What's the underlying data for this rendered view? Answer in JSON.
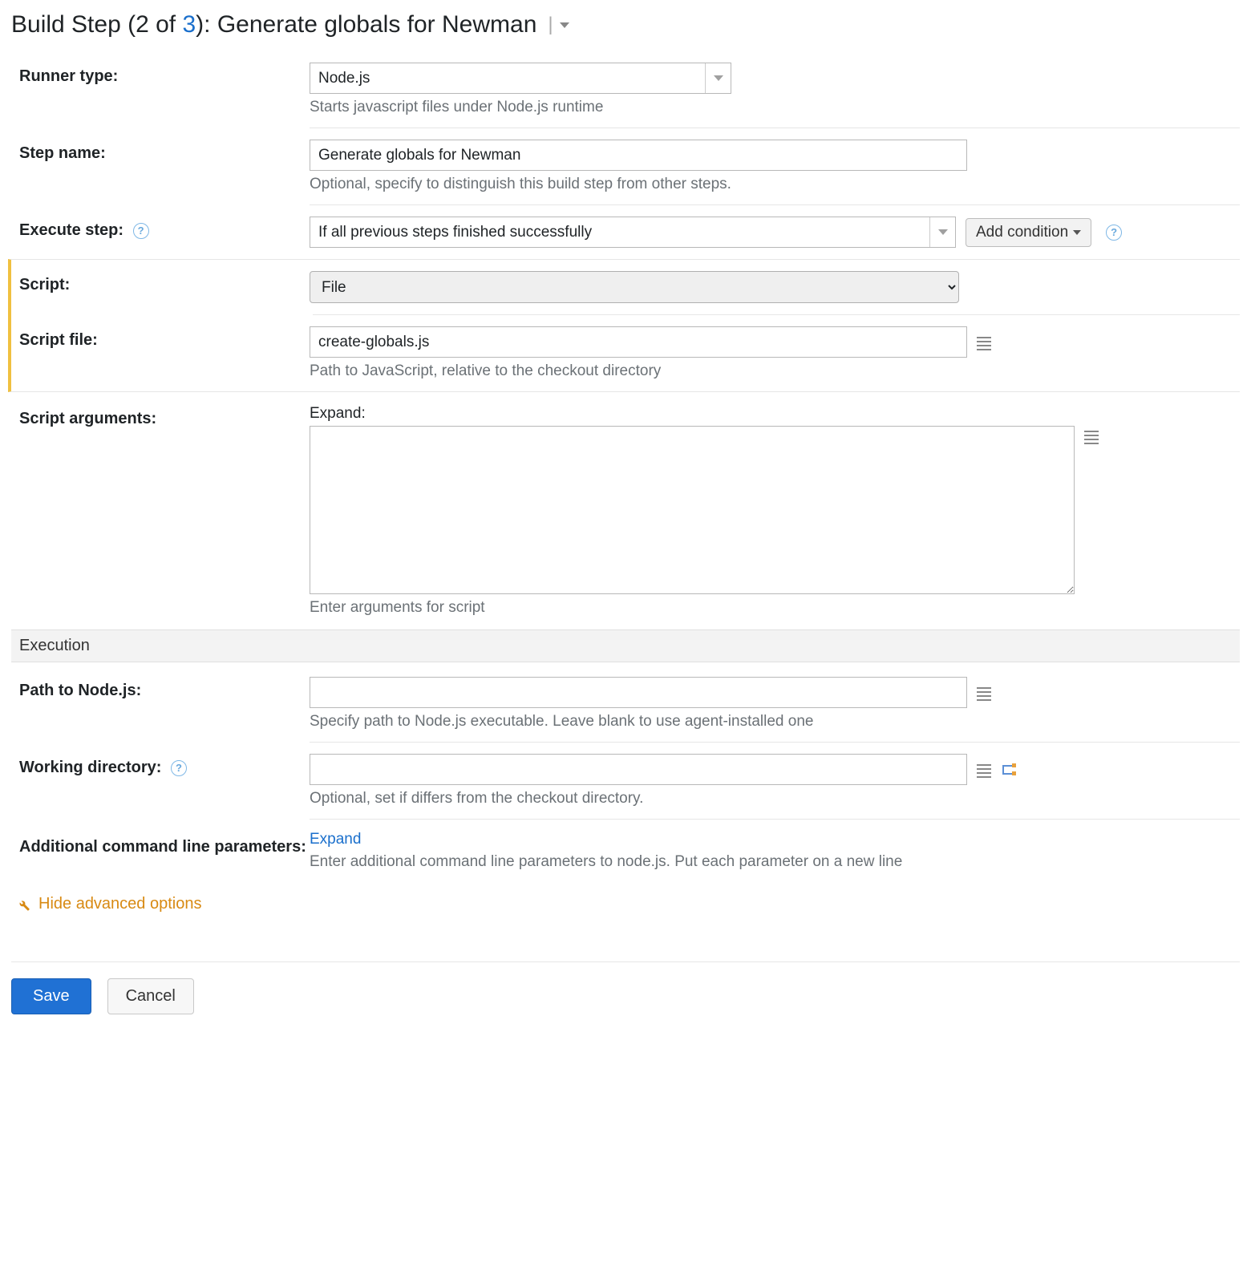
{
  "title": {
    "prefix": "Build Step (",
    "current": "2",
    "of": " of ",
    "total": "3",
    "suffix": "): Generate globals for Newman"
  },
  "runner": {
    "label": "Runner type:",
    "value": "Node.js",
    "help": "Starts javascript files under Node.js runtime"
  },
  "stepName": {
    "label": "Step name:",
    "value": "Generate globals for Newman",
    "help": "Optional, specify to distinguish this build step from other steps."
  },
  "executeStep": {
    "label": "Execute step:",
    "value": "If all previous steps finished successfully",
    "addCondition": "Add condition"
  },
  "script": {
    "label": "Script:",
    "value": "File"
  },
  "scriptFile": {
    "label": "Script file:",
    "value": "create-globals.js",
    "help": "Path to JavaScript, relative to the checkout directory"
  },
  "scriptArgs": {
    "label": "Script arguments:",
    "expand": "Expand:",
    "value": "",
    "help": "Enter arguments for script"
  },
  "execution": {
    "header": "Execution"
  },
  "pathNode": {
    "label": "Path to Node.js:",
    "value": "",
    "help": "Specify path to Node.js executable. Leave blank to use agent-installed one"
  },
  "workingDir": {
    "label": "Working directory:",
    "value": "",
    "help": "Optional, set if differs from the checkout directory."
  },
  "additionalParams": {
    "label": "Additional command line parameters:",
    "expand": "Expand",
    "help": "Enter additional command line parameters to node.js. Put each parameter on a new line"
  },
  "advToggle": "Hide advanced options",
  "buttons": {
    "save": "Save",
    "cancel": "Cancel"
  }
}
